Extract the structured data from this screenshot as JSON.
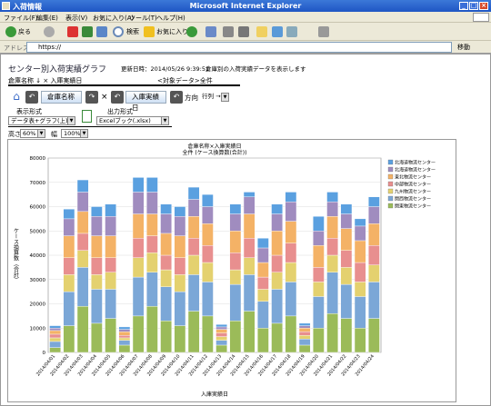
{
  "window": {
    "icon_text": "入",
    "title": "入荷情報",
    "center_title": "Microsoft Internet Explorer"
  },
  "menu": [
    "ファイル(F)",
    "編集(E)",
    "表示(V)",
    "お気に入り(A)",
    "ツール(T)",
    "ヘルプ(H)"
  ],
  "toolbar": {
    "back": "戻る",
    "search": "検索",
    "favorites": "お気に入り"
  },
  "address": {
    "label": "アドレス(D)",
    "value": "https://",
    "go": "移動"
  },
  "page": {
    "title": "センター別入荷実績グラフ",
    "updated": "更新日時：2014/05/26 9:39:51",
    "note": "倉庫別の入荷実績データを表示します",
    "breadcrumb": "倉庫名称 ↓ × 入庫実績日",
    "target": "<対象データ>全件",
    "tab1": "倉庫名称",
    "tab2": "入庫実績日",
    "times": "×",
    "direction_label": "方向",
    "direction_value": "行列 →",
    "display_label": "表示形式",
    "display_value": "データ表+グラフ(上)",
    "output_label": "出力形式",
    "output_value": "Excelブック(.xlsx)",
    "height_label": "高さ",
    "height_value": "60%",
    "width_label": "幅",
    "width_value": "100%"
  },
  "chart_data": {
    "type": "bar",
    "stacked": true,
    "title": "倉庫名称×入庫実績日",
    "subtitle": "全件 (ケース換算数(合計))",
    "xlabel": "入庫実績日",
    "ylabel": "ケース換算数（合計）",
    "ylim": [
      0,
      80000
    ],
    "yticks": [
      0,
      10000,
      20000,
      30000,
      40000,
      50000,
      60000,
      70000,
      80000
    ],
    "grid": true,
    "legend_position": "right",
    "categories": [
      "2014/04/01",
      "2014/04/02",
      "2014/04/03",
      "2014/04/04",
      "2014/04/05",
      "2014/04/06",
      "2014/04/07",
      "2014/04/08",
      "2014/04/09",
      "2014/04/10",
      "2014/04/11",
      "2014/04/12",
      "2014/04/13",
      "2014/04/14",
      "2014/04/15",
      "2014/04/16",
      "2014/04/17",
      "2014/04/18",
      "2014/04/19",
      "2014/04/20",
      "2014/04/21",
      "2014/04/22",
      "2014/04/23",
      "2014/04/24"
    ],
    "series": [
      {
        "name": "関東物流センター",
        "color": "#9bbb59",
        "values": [
          2000,
          11000,
          19000,
          12000,
          14000,
          3000,
          15000,
          19000,
          13000,
          11000,
          17000,
          15000,
          3000,
          13000,
          17000,
          10000,
          12000,
          15000,
          3000,
          10000,
          16000,
          14000,
          10000,
          14000
        ]
      },
      {
        "name": "関西物流センター",
        "color": "#7ba7d7",
        "values": [
          2500,
          14000,
          16000,
          14000,
          12000,
          2000,
          16000,
          14000,
          14000,
          14000,
          15000,
          14000,
          2000,
          15000,
          15000,
          11000,
          14000,
          14000,
          2500,
          13000,
          17000,
          14000,
          13000,
          15000
        ]
      },
      {
        "name": "九州物流センター",
        "color": "#e4d16f",
        "values": [
          1500,
          7000,
          7000,
          6000,
          7000,
          1000,
          8000,
          8000,
          7000,
          7000,
          8000,
          8000,
          1500,
          6000,
          7000,
          5000,
          7000,
          8000,
          1500,
          6000,
          7000,
          7000,
          6000,
          7000
        ]
      },
      {
        "name": "中部物流センター",
        "color": "#e88f8f",
        "values": [
          1500,
          7000,
          7000,
          7000,
          6000,
          1000,
          8000,
          7000,
          6000,
          7000,
          7000,
          7000,
          1500,
          7000,
          8000,
          5000,
          7000,
          8000,
          1500,
          6000,
          7000,
          7000,
          8000,
          8000
        ]
      },
      {
        "name": "東北物流センター",
        "color": "#f4b266",
        "values": [
          1500,
          9000,
          9000,
          9000,
          9000,
          1500,
          10000,
          9000,
          9000,
          9000,
          9000,
          9000,
          1500,
          9000,
          10000,
          6000,
          10000,
          9000,
          1500,
          9000,
          9000,
          9000,
          9000,
          9000
        ]
      },
      {
        "name": "北海道物流センター",
        "color": "#a08cbf",
        "values": [
          1000,
          7000,
          8000,
          8000,
          8000,
          1000,
          9000,
          9000,
          8000,
          8000,
          7000,
          7000,
          1000,
          7000,
          7000,
          6000,
          7000,
          8000,
          1000,
          6000,
          6000,
          6000,
          6000,
          7000
        ]
      },
      {
        "name": "北海道物流センター",
        "color": "#5aa0e0",
        "values": [
          1000,
          4000,
          5000,
          4000,
          5000,
          1000,
          6000,
          6000,
          4000,
          4000,
          5000,
          5000,
          1000,
          4000,
          2000,
          4000,
          4000,
          4000,
          1000,
          6000,
          4000,
          4000,
          3000,
          4000
        ]
      }
    ]
  }
}
